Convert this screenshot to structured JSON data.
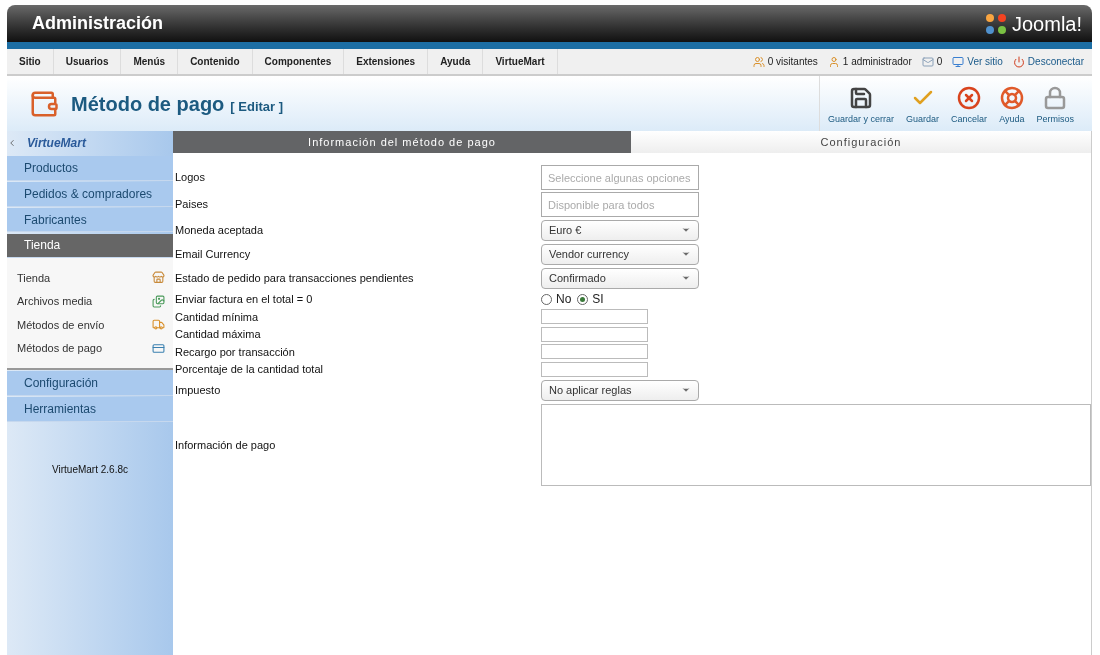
{
  "header": {
    "title": "Administración",
    "logo_text": "Joomla!"
  },
  "menu": [
    "Sitio",
    "Usuarios",
    "Menús",
    "Contenido",
    "Componentes",
    "Extensiones",
    "Ayuda",
    "VirtueMart"
  ],
  "status": [
    {
      "kind": "visitors",
      "label": "0 visitantes"
    },
    {
      "kind": "admins",
      "label": "1 administrador"
    },
    {
      "kind": "messages",
      "label": "0"
    },
    {
      "kind": "site",
      "label": "Ver sitio"
    },
    {
      "kind": "logout",
      "label": "Desconectar"
    }
  ],
  "page": {
    "title": "Método de pago",
    "subtitle": "[ Editar ]"
  },
  "toolbar": [
    {
      "kind": "save_close",
      "label": "Guardar y cerrar"
    },
    {
      "kind": "save",
      "label": "Guardar"
    },
    {
      "kind": "cancel",
      "label": "Cancelar"
    },
    {
      "kind": "help",
      "label": "Ayuda"
    },
    {
      "kind": "permissions",
      "label": "Permisos"
    }
  ],
  "sidebar": {
    "logo": "VirtueMart",
    "version": "VirtueMart 2.6.8c",
    "sections": [
      {
        "label": "Productos",
        "selected": false
      },
      {
        "label": "Pedidos & compradores",
        "selected": false
      },
      {
        "label": "Fabricantes",
        "selected": false
      },
      {
        "label": "Tienda",
        "selected": true,
        "children": [
          {
            "label": "Tienda",
            "kind": "shop"
          },
          {
            "label": "Archivos media",
            "kind": "media"
          },
          {
            "label": "Métodos de envío",
            "kind": "shipping"
          },
          {
            "label": "Métodos de pago",
            "kind": "payment"
          }
        ]
      },
      {
        "label": "Configuración",
        "selected": false
      },
      {
        "label": "Herramientas",
        "selected": false
      }
    ]
  },
  "tabs": [
    {
      "label": "Información del método de pago",
      "selected": true
    },
    {
      "label": "Configuración",
      "selected": false
    }
  ],
  "form": [
    {
      "kind": "multi",
      "label": "Logos",
      "placeholder": "Seleccione algunas opciones"
    },
    {
      "kind": "multi",
      "label": "Paises",
      "placeholder": "Disponible para todos"
    },
    {
      "kind": "select",
      "label": "Moneda aceptada",
      "value": "Euro €"
    },
    {
      "kind": "select",
      "label": "Email Currency",
      "value": "Vendor currency"
    },
    {
      "kind": "select",
      "label": "Estado de pedido para transacciones pendientes",
      "value": "Confirmado"
    },
    {
      "kind": "radio",
      "label": "Enviar factura en el total = 0",
      "options": [
        {
          "label": "No",
          "selected": false
        },
        {
          "label": "SI",
          "selected": true
        }
      ]
    },
    {
      "kind": "text",
      "label": "Cantidad mínima"
    },
    {
      "kind": "text",
      "label": "Cantidad máxima"
    },
    {
      "kind": "text",
      "label": "Recargo por transacción"
    },
    {
      "kind": "text",
      "label": "Porcentaje de la cantidad total"
    },
    {
      "kind": "select",
      "label": "Impuesto",
      "value": "No aplicar reglas"
    },
    {
      "kind": "textarea",
      "label": "Información de pago"
    }
  ]
}
